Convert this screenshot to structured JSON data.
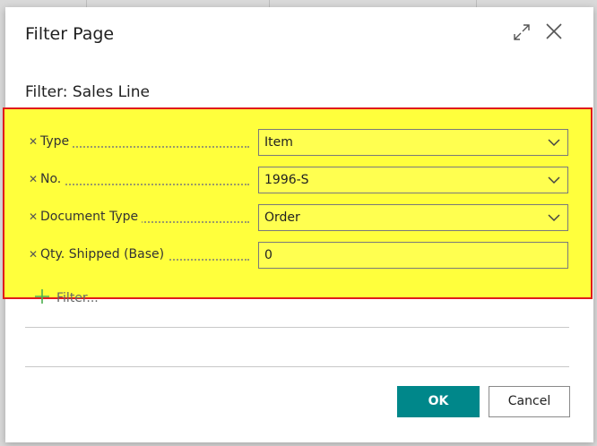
{
  "dialog": {
    "title": "Filter Page",
    "subtitle": "Filter: Sales Line"
  },
  "filters": [
    {
      "label": "Type",
      "value": "Item",
      "dropdown": true
    },
    {
      "label": "No.",
      "value": "1996-S",
      "dropdown": true
    },
    {
      "label": "Document Type",
      "value": "Order",
      "dropdown": true
    },
    {
      "label": "Qty. Shipped (Base)",
      "value": "0",
      "dropdown": false
    }
  ],
  "add_filter_label": "Filter...",
  "buttons": {
    "ok": "OK",
    "cancel": "Cancel"
  },
  "colors": {
    "highlight": "#ffff3c",
    "highlight_border": "#e01b1b",
    "primary": "#00878a",
    "plus": "#4caf50"
  },
  "icons": [
    "expand-icon",
    "close-icon",
    "remove-filter-icon",
    "chevron-down-icon",
    "add-icon"
  ]
}
